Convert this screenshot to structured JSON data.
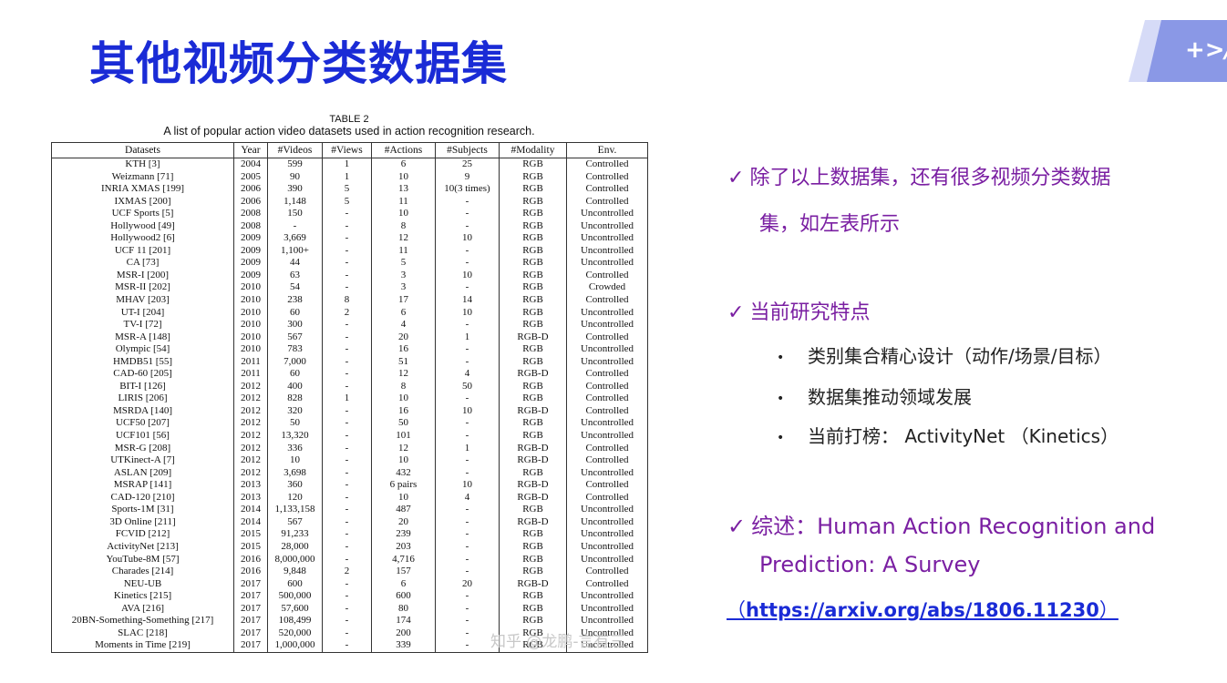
{
  "title": "其他视频分类数据集",
  "logo_text": "+>/",
  "table": {
    "caption_line1": "TABLE 2",
    "caption_line2": "A list of popular action video datasets used in action recognition research.",
    "headers": [
      "Datasets",
      "Year",
      "#Videos",
      "#Views",
      "#Actions",
      "#Subjects",
      "#Modality",
      "Env."
    ],
    "rows": [
      [
        "KTH [3]",
        "2004",
        "599",
        "1",
        "6",
        "25",
        "RGB",
        "Controlled"
      ],
      [
        "Weizmann [71]",
        "2005",
        "90",
        "1",
        "10",
        "9",
        "RGB",
        "Controlled"
      ],
      [
        "INRIA XMAS [199]",
        "2006",
        "390",
        "5",
        "13",
        "10(3 times)",
        "RGB",
        "Controlled"
      ],
      [
        "IXMAS [200]",
        "2006",
        "1,148",
        "5",
        "11",
        "-",
        "RGB",
        "Controlled"
      ],
      [
        "UCF Sports [5]",
        "2008",
        "150",
        "-",
        "10",
        "-",
        "RGB",
        "Uncontrolled"
      ],
      [
        "Hollywood [49]",
        "2008",
        "-",
        "-",
        "8",
        "-",
        "RGB",
        "Uncontrolled"
      ],
      [
        "Hollywood2 [6]",
        "2009",
        "3,669",
        "-",
        "12",
        "10",
        "RGB",
        "Uncontrolled"
      ],
      [
        "UCF 11 [201]",
        "2009",
        "1,100+",
        "-",
        "11",
        "-",
        "RGB",
        "Uncontrolled"
      ],
      [
        "CA [73]",
        "2009",
        "44",
        "-",
        "5",
        "-",
        "RGB",
        "Uncontrolled"
      ],
      [
        "MSR-I [200]",
        "2009",
        "63",
        "-",
        "3",
        "10",
        "RGB",
        "Controlled"
      ],
      [
        "MSR-II [202]",
        "2010",
        "54",
        "-",
        "3",
        "-",
        "RGB",
        "Crowded"
      ],
      [
        "MHAV [203]",
        "2010",
        "238",
        "8",
        "17",
        "14",
        "RGB",
        "Controlled"
      ],
      [
        "UT-I [204]",
        "2010",
        "60",
        "2",
        "6",
        "10",
        "RGB",
        "Uncontrolled"
      ],
      [
        "TV-I [72]",
        "2010",
        "300",
        "-",
        "4",
        "-",
        "RGB",
        "Uncontrolled"
      ],
      [
        "MSR-A [148]",
        "2010",
        "567",
        "-",
        "20",
        "1",
        "RGB-D",
        "Controlled"
      ],
      [
        "Olympic [54]",
        "2010",
        "783",
        "-",
        "16",
        "-",
        "RGB",
        "Uncontrolled"
      ],
      [
        "HMDB51 [55]",
        "2011",
        "7,000",
        "-",
        "51",
        "-",
        "RGB",
        "Uncontrolled"
      ],
      [
        "CAD-60 [205]",
        "2011",
        "60",
        "-",
        "12",
        "4",
        "RGB-D",
        "Controlled"
      ],
      [
        "BIT-I [126]",
        "2012",
        "400",
        "-",
        "8",
        "50",
        "RGB",
        "Controlled"
      ],
      [
        "LIRIS [206]",
        "2012",
        "828",
        "1",
        "10",
        "-",
        "RGB",
        "Controlled"
      ],
      [
        "MSRDA [140]",
        "2012",
        "320",
        "-",
        "16",
        "10",
        "RGB-D",
        "Controlled"
      ],
      [
        "UCF50 [207]",
        "2012",
        "50",
        "-",
        "50",
        "-",
        "RGB",
        "Uncontrolled"
      ],
      [
        "UCF101 [56]",
        "2012",
        "13,320",
        "-",
        "101",
        "-",
        "RGB",
        "Uncontrolled"
      ],
      [
        "MSR-G [208]",
        "2012",
        "336",
        "-",
        "12",
        "1",
        "RGB-D",
        "Controlled"
      ],
      [
        "UTKinect-A [7]",
        "2012",
        "10",
        "-",
        "10",
        "-",
        "RGB-D",
        "Controlled"
      ],
      [
        "ASLAN [209]",
        "2012",
        "3,698",
        "-",
        "432",
        "-",
        "RGB",
        "Uncontrolled"
      ],
      [
        "MSRAP [141]",
        "2013",
        "360",
        "-",
        "6 pairs",
        "10",
        "RGB-D",
        "Controlled"
      ],
      [
        "CAD-120 [210]",
        "2013",
        "120",
        "-",
        "10",
        "4",
        "RGB-D",
        "Controlled"
      ],
      [
        "Sports-1M [31]",
        "2014",
        "1,133,158",
        "-",
        "487",
        "-",
        "RGB",
        "Uncontrolled"
      ],
      [
        "3D Online [211]",
        "2014",
        "567",
        "-",
        "20",
        "-",
        "RGB-D",
        "Uncontrolled"
      ],
      [
        "FCVID [212]",
        "2015",
        "91,233",
        "-",
        "239",
        "-",
        "RGB",
        "Uncontrolled"
      ],
      [
        "ActivityNet [213]",
        "2015",
        "28,000",
        "-",
        "203",
        "-",
        "RGB",
        "Uncontrolled"
      ],
      [
        "YouTube-8M [57]",
        "2016",
        "8,000,000",
        "-",
        "4,716",
        "-",
        "RGB",
        "Uncontrolled"
      ],
      [
        "Charades [214]",
        "2016",
        "9,848",
        "2",
        "157",
        "-",
        "RGB",
        "Controlled"
      ],
      [
        "NEU-UB",
        "2017",
        "600",
        "-",
        "6",
        "20",
        "RGB-D",
        "Controlled"
      ],
      [
        "Kinetics [215]",
        "2017",
        "500,000",
        "-",
        "600",
        "-",
        "RGB",
        "Uncontrolled"
      ],
      [
        "AVA [216]",
        "2017",
        "57,600",
        "-",
        "80",
        "-",
        "RGB",
        "Uncontrolled"
      ],
      [
        "20BN-Something-Something [217]",
        "2017",
        "108,499",
        "-",
        "174",
        "-",
        "RGB",
        "Uncontrolled"
      ],
      [
        "SLAC [218]",
        "2017",
        "520,000",
        "-",
        "200",
        "-",
        "RGB",
        "Uncontrolled"
      ],
      [
        "Moments in Time [219]",
        "2017",
        "1,000,000",
        "-",
        "339",
        "-",
        "RGB",
        "Uncontrolled"
      ]
    ]
  },
  "watermark": "知乎 @龙鹏-言有三",
  "right": {
    "point1_line1": "除了以上数据集，还有很多视频分类数据",
    "point1_line2": "集，如左表所示",
    "point2": "当前研究特点",
    "bullets": [
      "类别集合精心设计（动作/场景/目标）",
      "数据集推动领域发展",
      "当前打榜： ActivityNet （Kinetics）"
    ],
    "point3_line1": "综述：Human Action Recognition and",
    "point3_line2": "Prediction: A Survey",
    "link_open": "（",
    "link_url": "https://arxiv.org/abs/1806.11230",
    "link_close": "）",
    "check_mark": "✓",
    "bullet_mark": "•"
  },
  "colors": {
    "title": "#1a2bd6",
    "accent_text": "#7a1fa2",
    "link": "#1a2bd6",
    "logo_bg": "#8a98e6"
  }
}
